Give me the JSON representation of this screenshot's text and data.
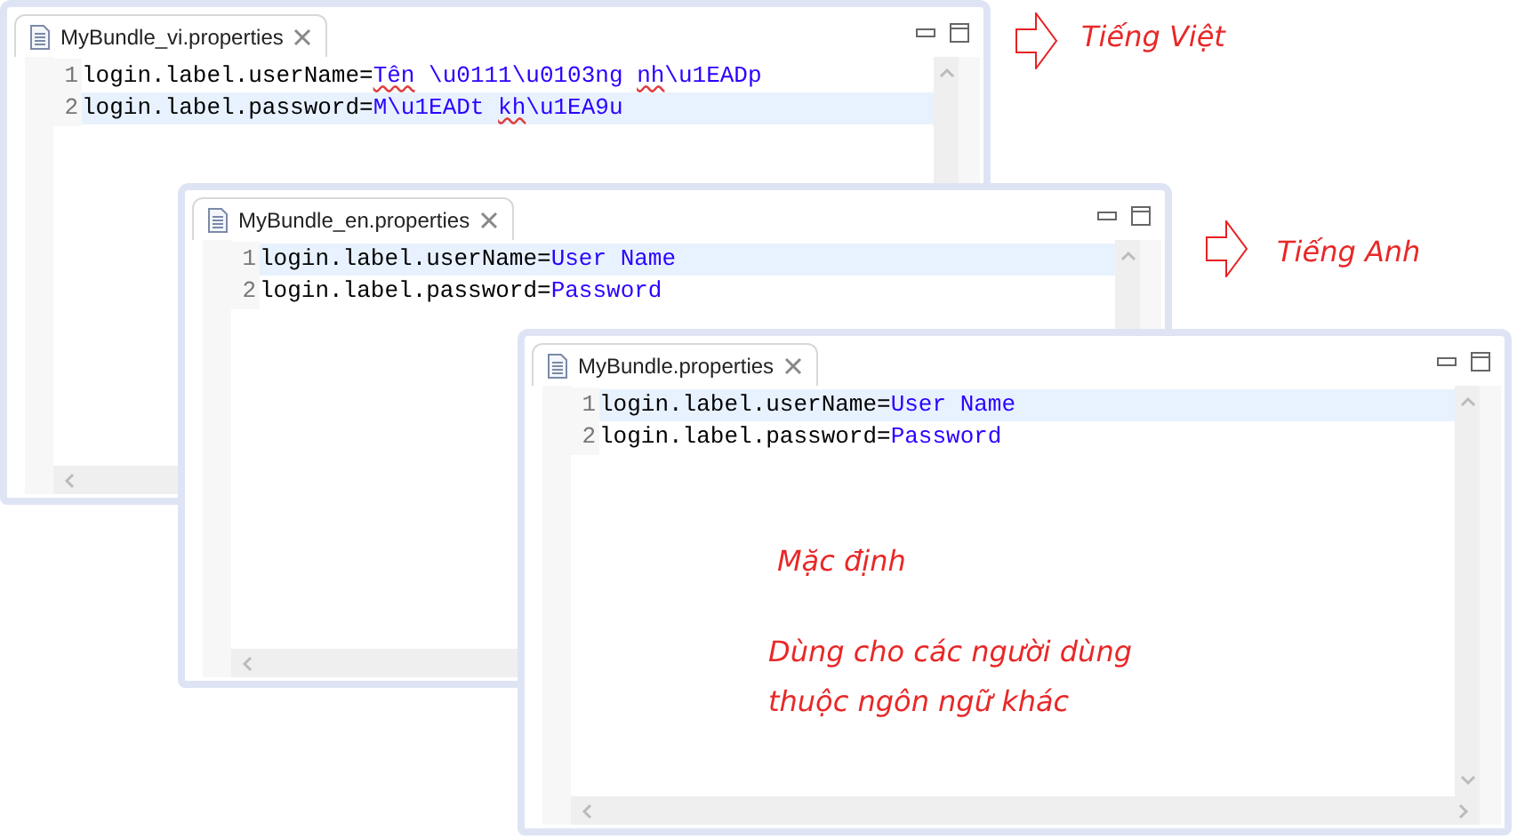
{
  "editors": [
    {
      "tab": {
        "label": "MyBundle_vi.properties"
      },
      "lines": [
        {
          "number": "1",
          "key": "login.label.userName=",
          "value": [
            {
              "text": "Tên",
              "misspelled": true
            },
            {
              "text": " \\u0111\\u0103ng ",
              "misspelled": false
            },
            {
              "text": "nh",
              "misspelled": true
            },
            {
              "text": "\\u1EADp",
              "misspelled": false
            }
          ],
          "current": false
        },
        {
          "number": "2",
          "key": "login.label.password=",
          "value": [
            {
              "text": "M\\u1EADt ",
              "misspelled": false
            },
            {
              "text": "kh",
              "misspelled": true
            },
            {
              "text": "\\u1EA9u",
              "misspelled": false
            }
          ],
          "current": true
        }
      ]
    },
    {
      "tab": {
        "label": "MyBundle_en.properties"
      },
      "lines": [
        {
          "number": "1",
          "key": "login.label.userName=",
          "value": [
            {
              "text": "User Name",
              "misspelled": false
            }
          ],
          "current": true
        },
        {
          "number": "2",
          "key": "login.label.password=",
          "value": [
            {
              "text": "Password",
              "misspelled": false
            }
          ],
          "current": false
        }
      ]
    },
    {
      "tab": {
        "label": "MyBundle.properties"
      },
      "lines": [
        {
          "number": "1",
          "key": "login.label.userName=",
          "value": [
            {
              "text": "User Name",
              "misspelled": false
            }
          ],
          "current": true
        },
        {
          "number": "2",
          "key": "login.label.password=",
          "value": [
            {
              "text": "Password",
              "misspelled": false
            }
          ],
          "current": false
        }
      ]
    }
  ],
  "annotations": [
    {
      "kind": "arrow-label",
      "text": "Tiếng Việt"
    },
    {
      "kind": "arrow-label",
      "text": "Tiếng Anh"
    },
    {
      "kind": "note",
      "text": "Mặc định"
    },
    {
      "kind": "note",
      "text": "Dùng cho các người dùng"
    },
    {
      "kind": "note",
      "text": "thuộc ngôn ngữ khác"
    }
  ]
}
